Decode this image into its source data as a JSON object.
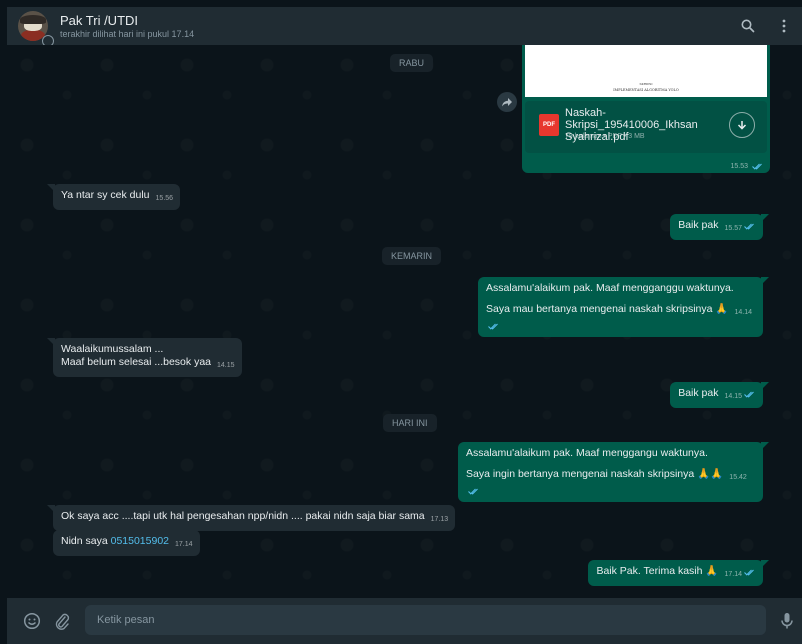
{
  "header": {
    "contact_name": "Pak Tri /UTDI",
    "status": "terakhir dilihat hari ini pukul 17.14"
  },
  "dates": {
    "rabu": "RABU",
    "kemarin": "KEMARIN",
    "hari_ini": "HARI INI"
  },
  "pdf": {
    "preview_line1": "SKRIPSI",
    "preview_line2": "IMPLEMENTASI ALGORITMA YOLO",
    "icon_label": "PDF",
    "file_name": "Naskah-Skripsi_195410006_Ikhsan Syahrizal.pdf",
    "file_meta": "79 halaman • PDF • 3 MB",
    "time": "15.53"
  },
  "messages": {
    "m1": {
      "text": "Ya ntar sy cek dulu",
      "time": "15.56"
    },
    "m2": {
      "text": "Baik pak",
      "time": "15.57"
    },
    "m3": {
      "line1": "Assalamu'alaikum pak. Maaf mengganggu waktunya.",
      "line2": "Saya mau bertanya mengenai naskah skripsinya 🙏",
      "time": "14.14"
    },
    "m4": {
      "line1": "Waalaikumussalam ...",
      "line2": "Maaf belum selesai ...besok yaa",
      "time": "14.15"
    },
    "m5": {
      "text": "Baik pak",
      "time": "14.15"
    },
    "m6": {
      "line1": "Assalamu'alaikum pak. Maaf menggangu waktunya.",
      "line2": "Saya ingin bertanya mengenai naskah skripsinya 🙏🙏",
      "time": "15.42"
    },
    "m7": {
      "text": "Ok saya acc ....tapi utk hal pengesahan npp/nidn .... pakai nidn saja biar sama",
      "time": "17.13"
    },
    "m8": {
      "prefix": "Nidn saya ",
      "number": "0515015902",
      "time": "17.14"
    },
    "m9": {
      "text": "Baik Pak. Terima kasih 🙏",
      "time": "17.14"
    }
  },
  "composer": {
    "placeholder": "Ketik pesan"
  },
  "icons": {
    "search": "search-icon",
    "menu": "kebab-menu-icon",
    "emoji": "emoji-icon",
    "attach": "paperclip-icon",
    "mic": "microphone-icon",
    "download": "download-icon",
    "forward": "forward-icon",
    "read_ticks": "double-check-icon"
  },
  "colors": {
    "app_bg": "#0b141a",
    "header_bg": "#202c33",
    "incoming_bubble": "#202c33",
    "outgoing_bubble": "#005c4b",
    "read_ticks": "#53bdeb",
    "link": "#53bdeb",
    "pdf_red": "#e7372e"
  }
}
